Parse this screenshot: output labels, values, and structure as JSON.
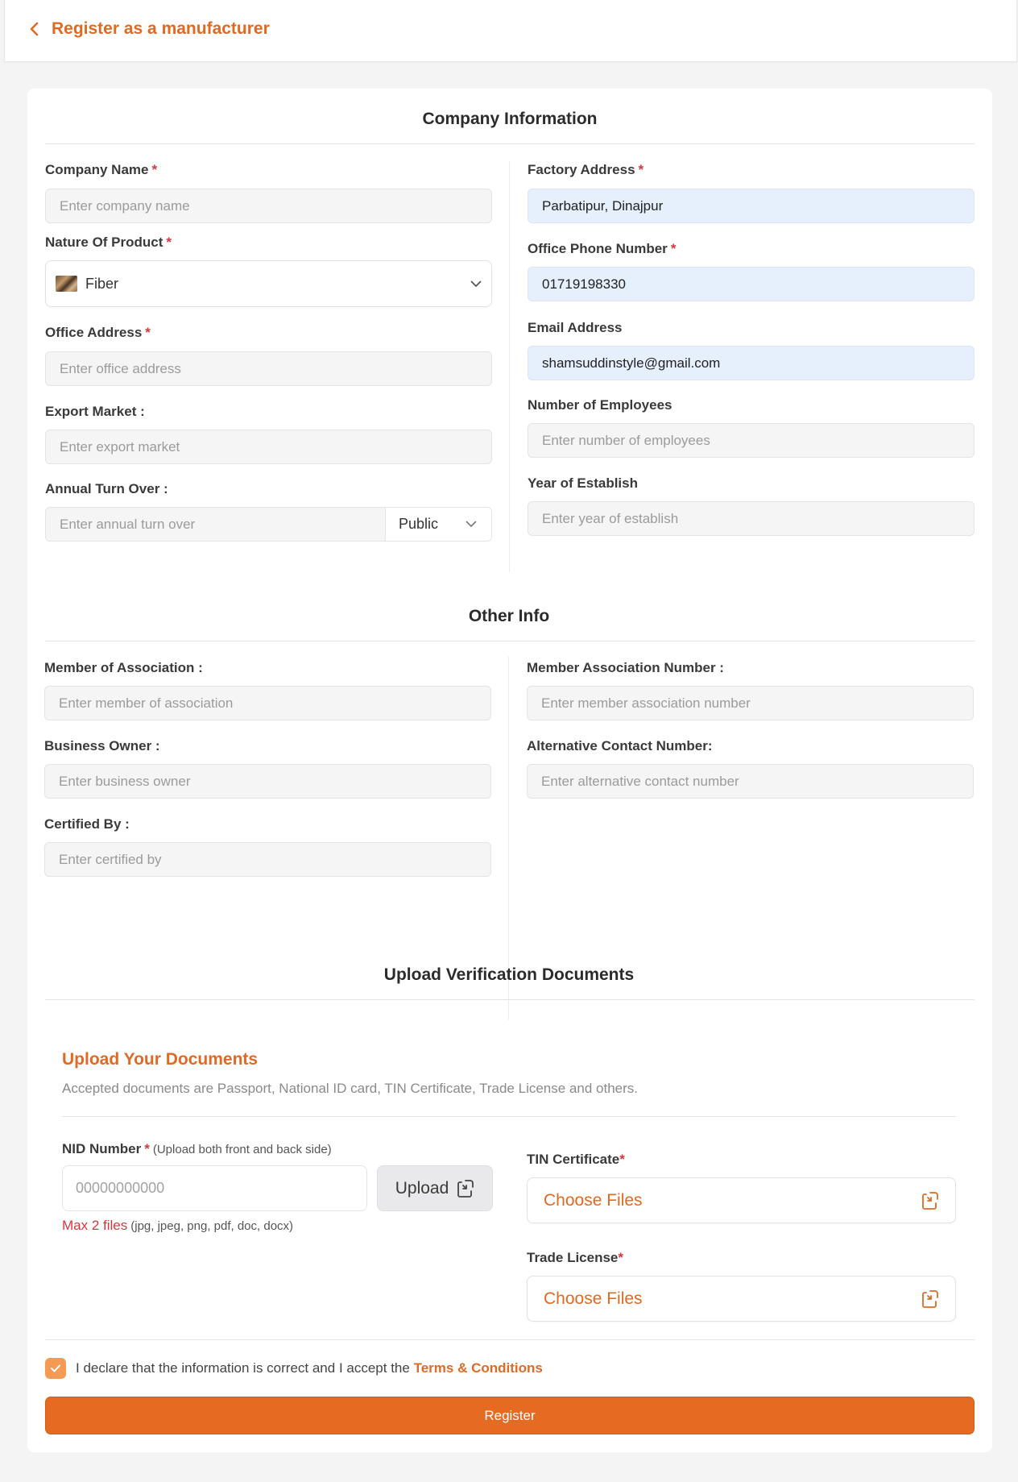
{
  "header": {
    "title": "Register as a manufacturer"
  },
  "company": {
    "section_title": "Company Information",
    "company_name": {
      "label": "Company Name",
      "placeholder": "Enter company name",
      "value": ""
    },
    "nature_of_product": {
      "label": "Nature Of Product",
      "selected": "Fiber"
    },
    "office_address": {
      "label": "Office Address",
      "placeholder": "Enter office address",
      "value": ""
    },
    "export_market": {
      "label": "Export Market :",
      "placeholder": "Enter export market",
      "value": ""
    },
    "annual_turnover": {
      "label": "Annual Turn Over :",
      "placeholder": "Enter annual turn over",
      "visibility": "Public"
    },
    "factory_address": {
      "label": "Factory Address",
      "value": "Parbatipur, Dinajpur"
    },
    "office_phone": {
      "label": "Office Phone Number",
      "value": "01719198330"
    },
    "email": {
      "label": "Email Address",
      "value": "shamsuddinstyle@gmail.com"
    },
    "employees": {
      "label": "Number of Employees",
      "placeholder": "Enter number of employees",
      "value": ""
    },
    "year_established": {
      "label": "Year of Establish",
      "placeholder": "Enter year of establish",
      "value": ""
    }
  },
  "other": {
    "section_title": "Other Info",
    "member_association": {
      "label": "Member of Association :",
      "placeholder": "Enter member of association"
    },
    "business_owner": {
      "label": "Business Owner :",
      "placeholder": "Enter business owner"
    },
    "certified_by": {
      "label": "Certified By :",
      "placeholder": "Enter certified by"
    },
    "member_association_number": {
      "label": "Member Association Number :",
      "placeholder": "Enter member association number"
    },
    "alternative_contact": {
      "label": "Alternative Contact Number:",
      "placeholder": "Enter alternative contact number"
    }
  },
  "documents": {
    "section_title": "Upload Verification Documents",
    "upload_title": "Upload Your Documents",
    "upload_desc": "Accepted documents are Passport, National ID card, TIN Certificate, Trade License and others.",
    "nid": {
      "label": "NID Number",
      "hint": "(Upload both front and back side)",
      "placeholder": "00000000000",
      "upload_label": "Upload",
      "max_files": "Max 2 files",
      "file_types": "(jpg, jpeg, png, pdf, doc, docx)"
    },
    "tin": {
      "label": "TIN Certificate",
      "choose_label": "Choose Files"
    },
    "trade_license": {
      "label": "Trade License",
      "choose_label": "Choose Files"
    }
  },
  "declaration": {
    "text": "I declare that the information is correct and I accept the",
    "link": "Terms & Conditions",
    "checked": true
  },
  "register_label": "Register",
  "colors": {
    "accent": "#e56b23",
    "required": "#d9363e",
    "filled_input": "#e6effc"
  },
  "icons": [
    "chevron-left-icon",
    "chevron-down-icon",
    "upload-icon",
    "checkmark-icon",
    "fiber-thumbnail"
  ]
}
